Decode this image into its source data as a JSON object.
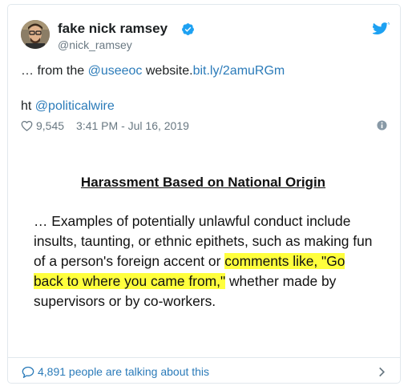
{
  "author": {
    "display_name": "fake nick ramsey",
    "handle": "@nick_ramsey",
    "verified": true
  },
  "tweet": {
    "line1_prefix": "… from the ",
    "line1_mention": "@useeoc",
    "line1_middle": " website.",
    "line1_link": "bit.ly/2amuRGm",
    "line2_prefix": "ht ",
    "line2_mention": "@politicalwire"
  },
  "meta": {
    "likes": "9,545",
    "timestamp": "3:41 PM - Jul 16, 2019"
  },
  "media": {
    "heading": "Harassment Based on National Origin",
    "line1": "… Examples of potentially unlawful conduct include",
    "line2": "insults, taunting, or ethnic epithets, such as making fun",
    "line3_plain": "of a person's foreign accent or ",
    "line3_highlight": "comments like, \"Go",
    "line4_highlight": "back to where you came from,\"",
    "line4_plain": " whether made by",
    "line5": "supervisors or by co-workers.",
    "highlight_color": "#ffff3d"
  },
  "footer": {
    "conversation_text": "4,891 people are talking about this"
  },
  "icons": {
    "verified": "verified-badge-icon",
    "twitter": "twitter-bird-icon",
    "like": "heart-icon",
    "info": "info-icon",
    "reply": "comment-icon",
    "more": "chevron-right-icon"
  },
  "colors": {
    "link": "#2b7bb9",
    "muted": "#697882",
    "text": "#1c2022",
    "border": "#e1e8ed"
  }
}
